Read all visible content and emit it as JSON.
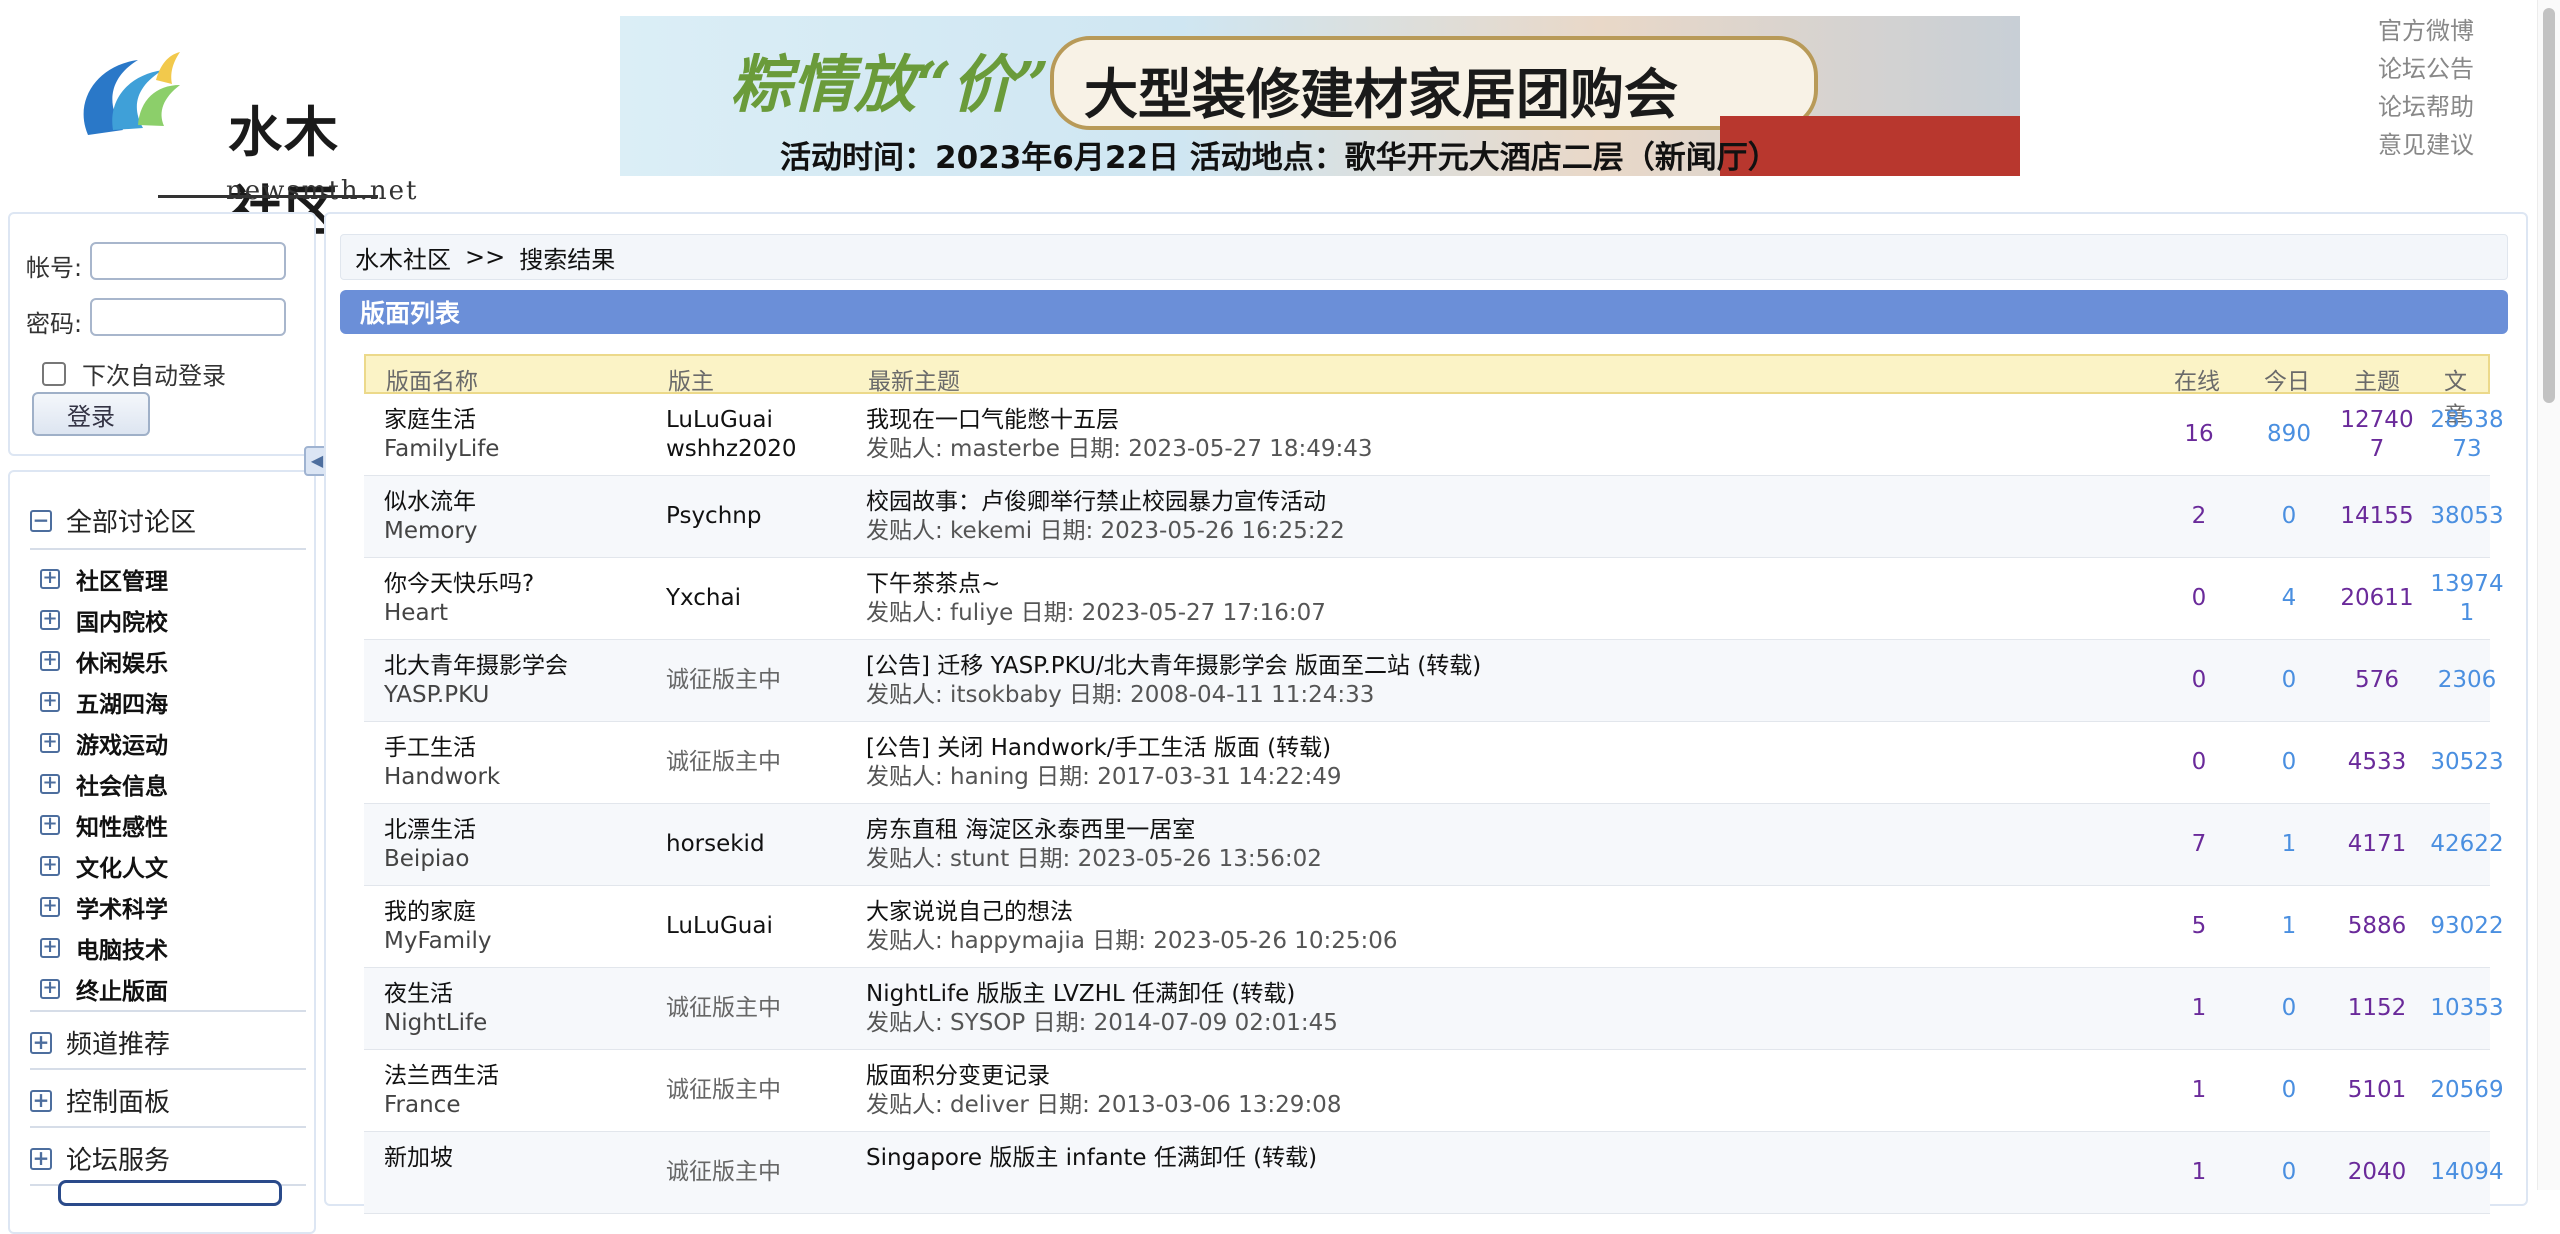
{
  "header": {
    "logo_text": "水木社区",
    "logo_sub": "newsmth.net",
    "banner_slogan": "粽情放“价”",
    "banner_title": "大型装修建材家居团购会",
    "banner_info": "活动时间：2023年6月22日    活动地点：歌华开元大酒店二层（新闻厅）",
    "links": [
      "官方微博",
      "论坛公告",
      "论坛帮助",
      "意见建议"
    ]
  },
  "login": {
    "account_label": "帐号:",
    "password_label": "密码:",
    "remember_label": "下次自动登录",
    "login_button": "登录"
  },
  "nav": {
    "all_sections": "全部讨论区",
    "categories": [
      "社区管理",
      "国内院校",
      "休闲娱乐",
      "五湖四海",
      "游戏运动",
      "社会信息",
      "知性感性",
      "文化人文",
      "学术科学",
      "电脑技术",
      "终止版面"
    ],
    "channel_recommend": "频道推荐",
    "control_panel": "控制面板",
    "forum_services": "论坛服务"
  },
  "breadcrumb": {
    "home": "水木社区",
    "sep": ">>",
    "current": "搜索结果"
  },
  "section_title": "版面列表",
  "table": {
    "headers": {
      "name": "版面名称",
      "moderator": "版主",
      "latest": "最新主题",
      "online": "在线",
      "today": "今日",
      "topics": "主题",
      "posts": "文章"
    },
    "rows": [
      {
        "name": "家庭生活",
        "en": "FamilyLife",
        "mod1": "LuLuGuai",
        "mod2": "wshhz2020",
        "topic": "我现在一口气能憋十五层",
        "meta": "发贴人: masterbe 日期: 2023-05-27 18:49:43",
        "online": "16",
        "today": "890",
        "topics1": "12740",
        "topics2": "7",
        "posts1": "28538",
        "posts2": "73"
      },
      {
        "name": "似水流年",
        "en": "Memory",
        "mod1": "Psychnp",
        "mod2": "",
        "topic": "校园故事：卢俊卿举行禁止校园暴力宣传活动",
        "meta": "发贴人: kekemi 日期: 2023-05-26 16:25:22",
        "online": "2",
        "today": "0",
        "topics1": "14155",
        "topics2": "",
        "posts1": "38053",
        "posts2": ""
      },
      {
        "name": "你今天快乐吗?",
        "en": "Heart",
        "mod1": "Yxchai",
        "mod2": "",
        "topic": "下午茶茶点~",
        "meta": "发贴人: fuliye 日期: 2023-05-27 17:16:07",
        "online": "0",
        "today": "4",
        "topics1": "20611",
        "topics2": "",
        "posts1": "13974",
        "posts2": "1"
      },
      {
        "name": "北大青年摄影学会",
        "en": "YASP.PKU",
        "mod1": "诚征版主中",
        "mod2": "",
        "topic": "[公告] 迁移 YASP.PKU/北大青年摄影学会 版面至二站 (转载)",
        "meta": "发贴人: itsokbaby 日期: 2008-04-11 11:24:33",
        "online": "0",
        "today": "0",
        "topics1": "576",
        "topics2": "",
        "posts1": "2306",
        "posts2": ""
      },
      {
        "name": "手工生活",
        "en": "Handwork",
        "mod1": "诚征版主中",
        "mod2": "",
        "topic": "[公告] 关闭 Handwork/手工生活 版面 (转载)",
        "meta": "发贴人: haning 日期: 2017-03-31 14:22:49",
        "online": "0",
        "today": "0",
        "topics1": "4533",
        "topics2": "",
        "posts1": "30523",
        "posts2": ""
      },
      {
        "name": "北漂生活",
        "en": "Beipiao",
        "mod1": "horsekid",
        "mod2": "",
        "topic": "房东直租 海淀区永泰西里一居室",
        "meta": "发贴人: stunt 日期: 2023-05-26 13:56:02",
        "online": "7",
        "today": "1",
        "topics1": "4171",
        "topics2": "",
        "posts1": "42622",
        "posts2": ""
      },
      {
        "name": "我的家庭",
        "en": "MyFamily",
        "mod1": "LuLuGuai",
        "mod2": "",
        "topic": "大家说说自己的想法",
        "meta": "发贴人: happymajia 日期: 2023-05-26 10:25:06",
        "online": "5",
        "today": "1",
        "topics1": "5886",
        "topics2": "",
        "posts1": "93022",
        "posts2": ""
      },
      {
        "name": "夜生活",
        "en": "NightLife",
        "mod1": "诚征版主中",
        "mod2": "",
        "topic": "NightLife 版版主 LVZHL 任满卸任 (转载)",
        "meta": "发贴人: SYSOP 日期: 2014-07-09 02:01:45",
        "online": "1",
        "today": "0",
        "topics1": "1152",
        "topics2": "",
        "posts1": "10353",
        "posts2": ""
      },
      {
        "name": "法兰西生活",
        "en": "France",
        "mod1": "诚征版主中",
        "mod2": "",
        "topic": "版面积分变更记录",
        "meta": "发贴人: deliver 日期: 2013-03-06 13:29:08",
        "online": "1",
        "today": "0",
        "topics1": "5101",
        "topics2": "",
        "posts1": "20569",
        "posts2": ""
      },
      {
        "name": "新加坡",
        "en": "",
        "mod1": "诚征版主中",
        "mod2": "",
        "topic": "Singapore 版版主 infante 任满卸任 (转载)",
        "meta": "",
        "online": "1",
        "today": "0",
        "topics1": "2040",
        "topics2": "",
        "posts1": "14094",
        "posts2": ""
      }
    ]
  }
}
